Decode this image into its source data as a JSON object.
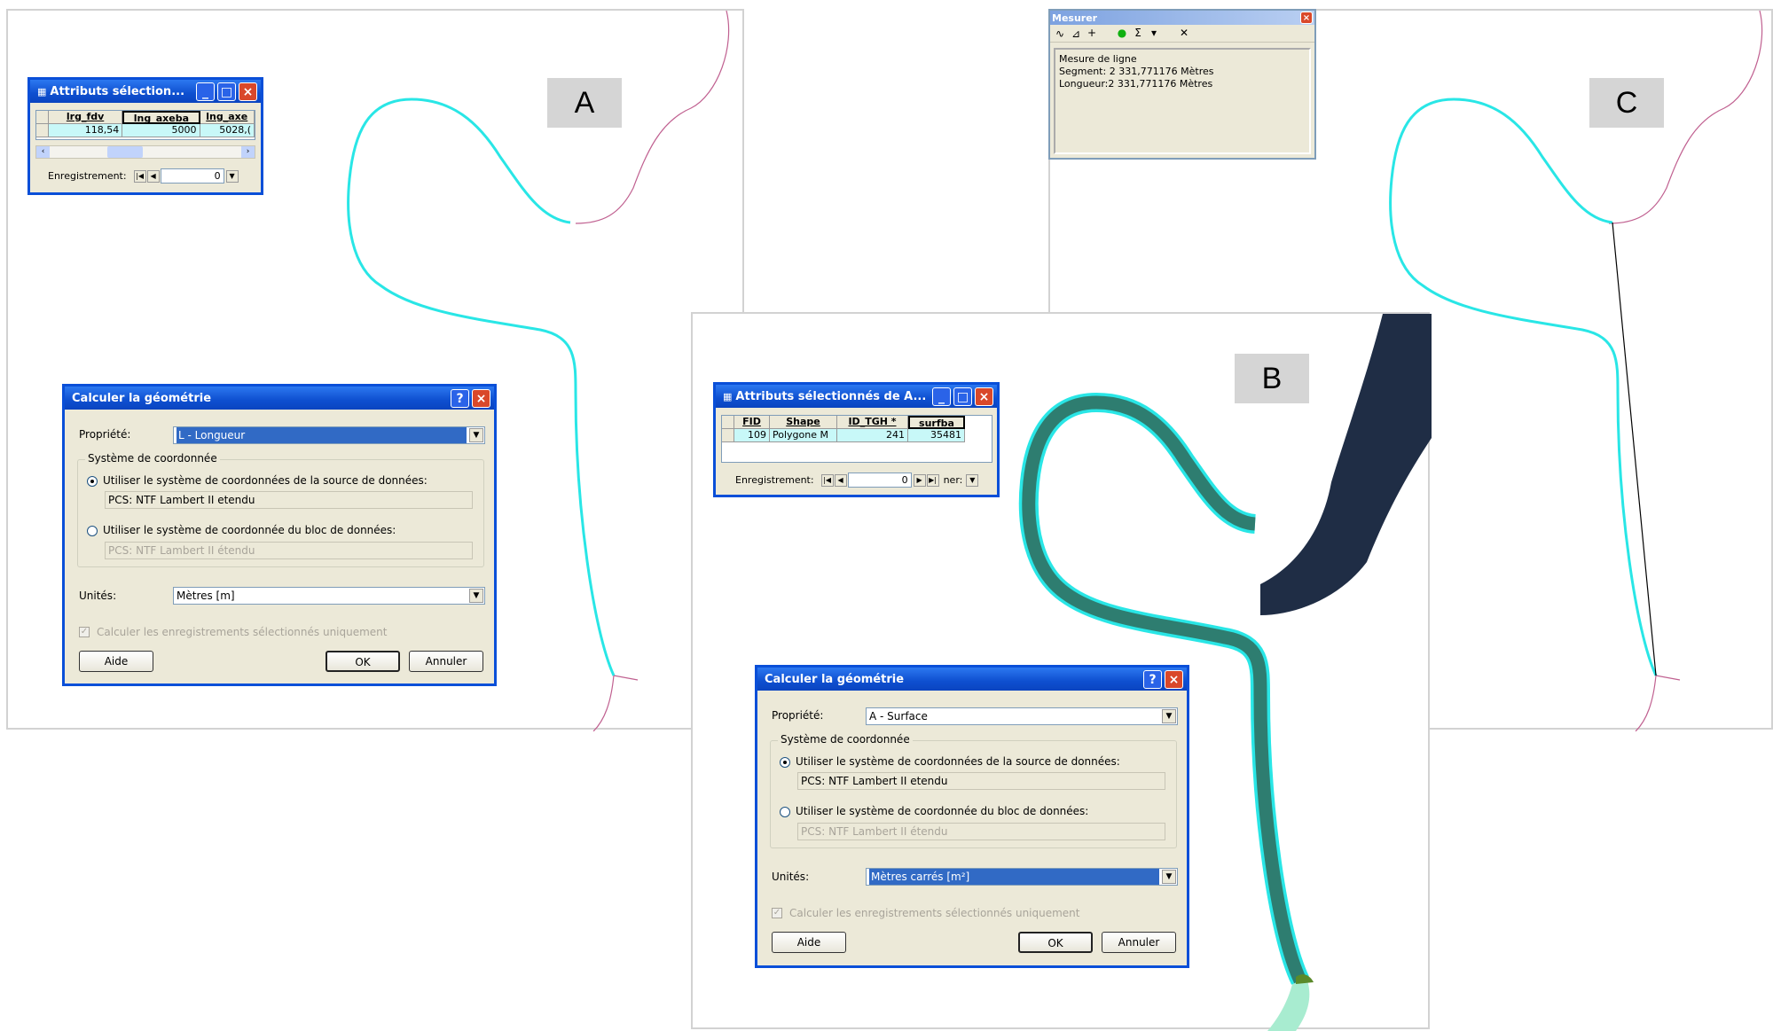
{
  "panels": {
    "a": {
      "label": "A"
    },
    "b": {
      "label": "B"
    },
    "c": {
      "label": "C"
    }
  },
  "colors": {
    "river_line": "#29e6e6",
    "polygon_fill": "#2e7d70",
    "water_body": "#1f2d45",
    "downstream": "#a8ecd0",
    "boundary": "#c06090"
  },
  "calc_a": {
    "title": "Calculer la géométrie",
    "property_label": "Propriété:",
    "property_value": "L - Longueur",
    "coord_group": "Système de coordonnée",
    "radio_source": "Utiliser le système de coordonnées de la source de données:",
    "source_pcs": "PCS: NTF Lambert II etendu",
    "radio_frame": "Utiliser le système de coordonnée du bloc de données:",
    "frame_pcs": "PCS: NTF Lambert II étendu",
    "units_label": "Unités:",
    "units_value": "Mètres [m]",
    "selected_only": "Calculer les enregistrements sélectionnés uniquement",
    "help": "Aide",
    "ok": "OK",
    "cancel": "Annuler"
  },
  "calc_b": {
    "title": "Calculer la géométrie",
    "property_label": "Propriété:",
    "property_value": "A - Surface",
    "coord_group": "Système de coordonnée",
    "radio_source": "Utiliser le système de coordonnées de la source de données:",
    "source_pcs": "PCS: NTF Lambert II etendu",
    "radio_frame": "Utiliser le système de coordonnée du bloc de données:",
    "frame_pcs": "PCS: NTF Lambert II étendu",
    "units_label": "Unités:",
    "units_value": "Mètres carrés [m²]",
    "selected_only": "Calculer les enregistrements sélectionnés uniquement",
    "help": "Aide",
    "ok": "OK",
    "cancel": "Annuler"
  },
  "attr_a": {
    "title": "Attributs sélection...",
    "headers": [
      "lrg_fdv",
      "lng_axeba",
      "lng_axe"
    ],
    "row": [
      "118,54",
      "5000",
      "5028,("
    ],
    "record_label": "Enregistrement:",
    "record_value": "0"
  },
  "attr_b": {
    "title": "Attributs sélectionnés de A...",
    "headers": [
      "FID",
      "Shape",
      "ID_TGH *",
      "surfba"
    ],
    "row": [
      "109",
      "Polygone M",
      "241",
      "35481"
    ],
    "record_label": "Enregistrement:",
    "record_value": "0",
    "trailing": "ner:"
  },
  "measure": {
    "title": "Mesurer",
    "line1": "Mesure de ligne",
    "line2": "Segment: 2 331,771176 Mètres",
    "line3": "Longueur:2 331,771176 Mètres"
  }
}
